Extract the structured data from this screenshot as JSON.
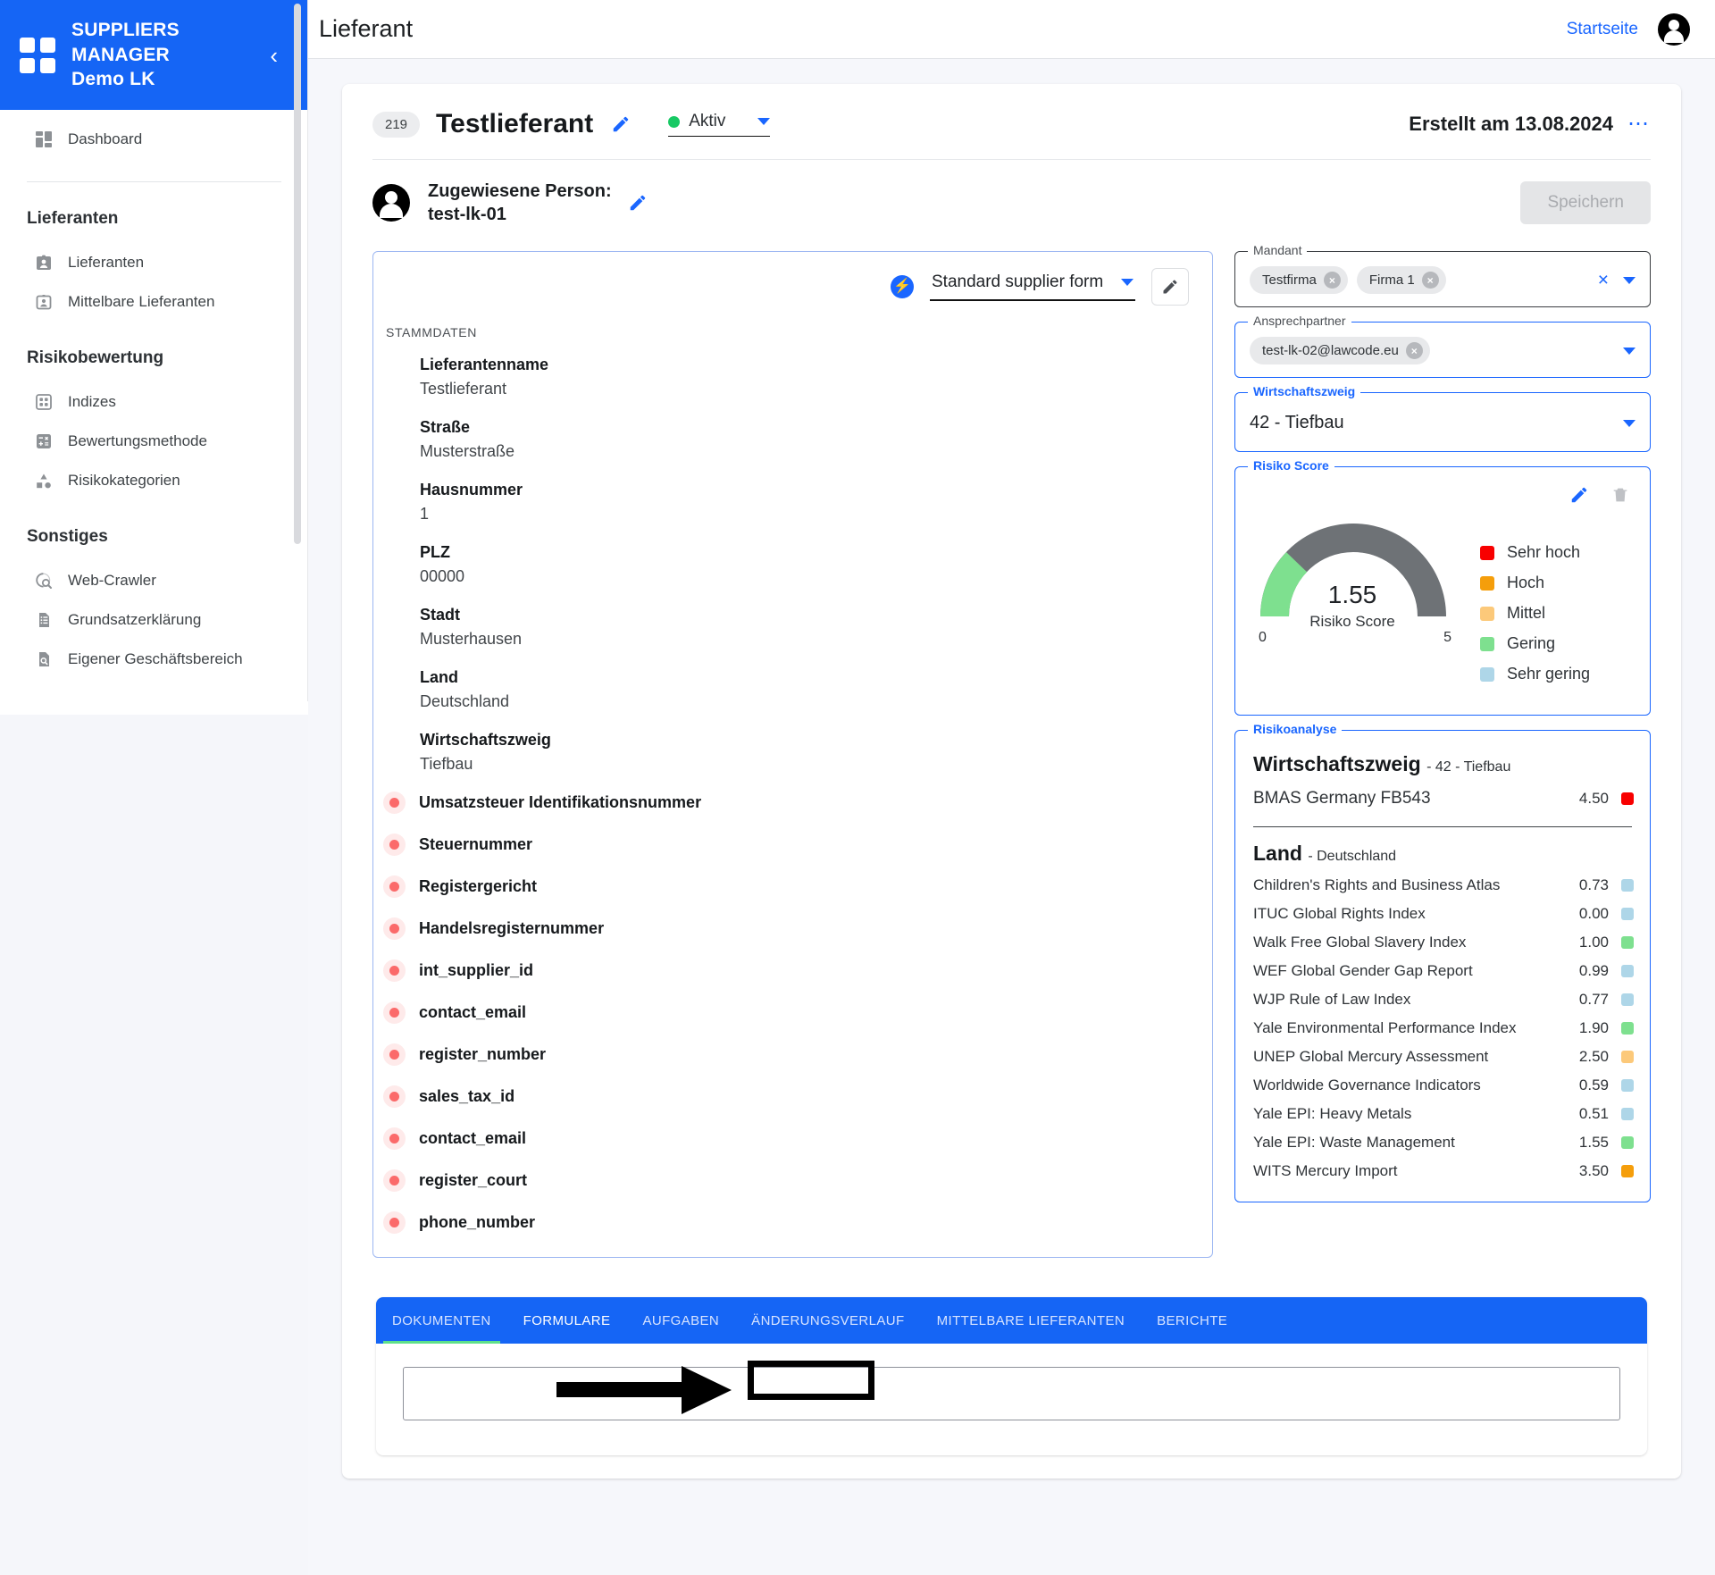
{
  "brand": {
    "line1": "SUPPLIERS",
    "line2": "MANAGER",
    "line3": "Demo LK",
    "collapse_icon": "chevron-left-icon"
  },
  "sidebar": {
    "dashboard": {
      "label": "Dashboard",
      "icon": "dashboard-icon"
    },
    "groups": [
      {
        "title": "Lieferanten",
        "items": [
          {
            "label": "Lieferanten",
            "icon": "id-card-icon"
          },
          {
            "label": "Mittelbare Lieferanten",
            "icon": "id-card-outline-icon"
          }
        ]
      },
      {
        "title": "Risikobewertung",
        "items": [
          {
            "label": "Indizes",
            "icon": "grid-icon"
          },
          {
            "label": "Bewertungsmethode",
            "icon": "calculator-icon"
          },
          {
            "label": "Risikokategorien",
            "icon": "shapes-icon"
          }
        ]
      },
      {
        "title": "Sonstiges",
        "items": [
          {
            "label": "Web-Crawler",
            "icon": "web-search-icon"
          },
          {
            "label": "Grundsatzerklärung",
            "icon": "document-list-icon"
          },
          {
            "label": "Eigener Geschäftsbereich",
            "icon": "document-search-icon"
          }
        ]
      }
    ]
  },
  "topbar": {
    "title": "Lieferant",
    "home_link": "Startseite",
    "avatar_icon": "account-circle-icon"
  },
  "supplier": {
    "id": "219",
    "name": "Testlieferant",
    "edit_icon": "pencil-icon",
    "status": "Aktiv",
    "status_color": "#17c964",
    "status_caret_icon": "chevron-down-icon",
    "created": "Erstellt am 13.08.2024",
    "more_icon": "more-horizontal-icon",
    "assigned_person_label": "Zugewiesene Person:",
    "assigned_person_value": "test-lk-01",
    "assigned_person_icon": "account-circle-icon",
    "save_label": "Speichern"
  },
  "form": {
    "bolt_icon": "lightning-bolt-icon",
    "template_name": "Standard supplier form",
    "template_caret_icon": "chevron-down-icon",
    "edit_icon": "pencil-icon",
    "section_label": "STAMMDATEN",
    "fields": [
      {
        "label": "Lieferantenname",
        "value": "Testlieferant"
      },
      {
        "label": "Straße",
        "value": "Musterstraße"
      },
      {
        "label": "Hausnummer",
        "value": "1"
      },
      {
        "label": "PLZ",
        "value": "00000"
      },
      {
        "label": "Stadt",
        "value": "Musterhausen"
      },
      {
        "label": "Land",
        "value": "Deutschland"
      },
      {
        "label": "Wirtschaftszweig",
        "value": "Tiefbau"
      }
    ],
    "missing_fields": [
      "Umsatzsteuer Identifikationsnummer",
      "Steuernummer",
      "Registergericht",
      "Handelsregisternummer",
      "int_supplier_id",
      "contact_email",
      "register_number",
      "sales_tax_id",
      "contact_email",
      "register_court",
      "phone_number"
    ],
    "missing_dot_color": "#fb6a6a"
  },
  "right": {
    "mandant": {
      "legend": "Mandant",
      "chips": [
        "Testfirma",
        "Firma 1"
      ],
      "clear_icon": "close-icon",
      "caret_icon": "chevron-down-icon"
    },
    "ansprechpartner": {
      "legend": "Ansprechpartner",
      "chips": [
        "test-lk-02@lawcode.eu"
      ],
      "caret_icon": "chevron-down-icon"
    },
    "wirtschaftszweig": {
      "legend": "Wirtschaftszweig",
      "value": "42 - Tiefbau",
      "caret_icon": "chevron-down-icon"
    },
    "risiko_score": {
      "legend": "Risiko Score",
      "edit_icon": "pencil-icon",
      "delete_icon": "trash-icon",
      "value": "1.55",
      "caption": "Risiko Score",
      "scale_min": "0",
      "scale_max": "5",
      "legend_items": [
        {
          "label": "Sehr hoch",
          "color": "#f80000"
        },
        {
          "label": "Hoch",
          "color": "#f59e0b"
        },
        {
          "label": "Mittel",
          "color": "#fcc97a"
        },
        {
          "label": "Gering",
          "color": "#7ee08f"
        },
        {
          "label": "Sehr gering",
          "color": "#aed6e8"
        }
      ]
    },
    "risikoanalyse": {
      "legend": "Risikoanalyse",
      "branch_title": "Wirtschaftszweig",
      "branch_sub": "- 42 - Tiefbau",
      "branch_rows": [
        {
          "name": "BMAS Germany FB543",
          "value": "4.50",
          "color": "#f80000"
        }
      ],
      "country_title": "Land",
      "country_sub": "- Deutschland",
      "country_rows": [
        {
          "name": "Children's Rights and Business Atlas",
          "value": "0.73",
          "color": "#aed6e8"
        },
        {
          "name": "ITUC Global Rights Index",
          "value": "0.00",
          "color": "#aed6e8"
        },
        {
          "name": "Walk Free Global Slavery Index",
          "value": "1.00",
          "color": "#7ee08f"
        },
        {
          "name": "WEF Global Gender Gap Report",
          "value": "0.99",
          "color": "#aed6e8"
        },
        {
          "name": "WJP Rule of Law Index",
          "value": "0.77",
          "color": "#aed6e8"
        },
        {
          "name": "Yale Environmental Performance Index",
          "value": "1.90",
          "color": "#7ee08f"
        },
        {
          "name": "UNEP Global Mercury Assessment",
          "value": "2.50",
          "color": "#fcc97a"
        },
        {
          "name": "Worldwide Governance Indicators",
          "value": "0.59",
          "color": "#aed6e8"
        },
        {
          "name": "Yale EPI: Heavy Metals",
          "value": "0.51",
          "color": "#aed6e8"
        },
        {
          "name": "Yale EPI: Waste Management",
          "value": "1.55",
          "color": "#7ee08f"
        },
        {
          "name": "WITS Mercury Import",
          "value": "3.50",
          "color": "#f59e0b"
        }
      ]
    }
  },
  "tabs": {
    "items": [
      {
        "label": "DOKUMENTEN",
        "active": false
      },
      {
        "label": "FORMULARE",
        "active": true
      },
      {
        "label": "AUFGABEN",
        "active": false
      },
      {
        "label": "ÄNDERUNGSVERLAUF",
        "active": false
      },
      {
        "label": "MITTELBARE LIEFERANTEN",
        "active": false
      },
      {
        "label": "BERICHTE",
        "active": false
      }
    ],
    "note_value": "",
    "note_placeholder": ""
  },
  "colors": {
    "brand_blue": "#1565f5",
    "link_blue": "#1a66ff",
    "accent_green": "#17c964"
  }
}
